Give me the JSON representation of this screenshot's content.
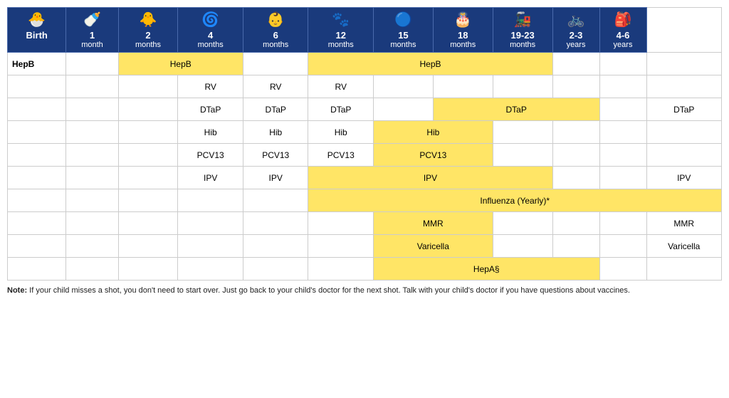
{
  "headers": [
    {
      "icon": "🐣",
      "age": "Birth",
      "sub": ""
    },
    {
      "icon": "🍼",
      "age": "1",
      "sub": "month"
    },
    {
      "icon": "🐥",
      "age": "2",
      "sub": "months"
    },
    {
      "icon": "🌀",
      "age": "4",
      "sub": "months"
    },
    {
      "icon": "👶",
      "age": "6",
      "sub": "months"
    },
    {
      "icon": "🐾",
      "age": "12",
      "sub": "months"
    },
    {
      "icon": "🔵",
      "age": "15",
      "sub": "months"
    },
    {
      "icon": "🎂",
      "age": "18",
      "sub": "months"
    },
    {
      "icon": "🚂",
      "age": "19-23",
      "sub": "months"
    },
    {
      "icon": "🚲",
      "age": "2-3",
      "sub": "years"
    },
    {
      "icon": "🎒",
      "age": "4-6",
      "sub": "years"
    }
  ],
  "rows": [
    {
      "vaccine": "HepB",
      "cells": [
        {
          "col": 0,
          "label": "",
          "yellow": false
        },
        {
          "col": 1,
          "label": "HepB",
          "yellow": true,
          "span": 2
        },
        {
          "col": 3,
          "label": "",
          "yellow": false
        },
        {
          "col": 4,
          "label": "HepB",
          "yellow": true,
          "span": 4
        },
        {
          "col": 8,
          "label": "",
          "yellow": false
        },
        {
          "col": 9,
          "label": "",
          "yellow": false
        },
        {
          "col": 10,
          "label": "",
          "yellow": false
        }
      ]
    },
    {
      "vaccine": "",
      "cells": [
        {
          "col": 0,
          "label": "",
          "yellow": false
        },
        {
          "col": 1,
          "label": "",
          "yellow": false
        },
        {
          "col": 2,
          "label": "RV",
          "yellow": false
        },
        {
          "col": 3,
          "label": "RV",
          "yellow": false
        },
        {
          "col": 4,
          "label": "RV",
          "yellow": false
        },
        {
          "col": 5,
          "label": "",
          "yellow": false
        },
        {
          "col": 6,
          "label": "",
          "yellow": false
        },
        {
          "col": 7,
          "label": "",
          "yellow": false
        },
        {
          "col": 8,
          "label": "",
          "yellow": false
        },
        {
          "col": 9,
          "label": "",
          "yellow": false
        },
        {
          "col": 10,
          "label": "",
          "yellow": false
        }
      ]
    },
    {
      "vaccine": "",
      "cells": [
        {
          "col": 0,
          "label": "",
          "yellow": false
        },
        {
          "col": 1,
          "label": "",
          "yellow": false
        },
        {
          "col": 2,
          "label": "DTaP",
          "yellow": false
        },
        {
          "col": 3,
          "label": "DTaP",
          "yellow": false
        },
        {
          "col": 4,
          "label": "DTaP",
          "yellow": false
        },
        {
          "col": 5,
          "label": "",
          "yellow": false
        },
        {
          "col": 6,
          "label": "DTaP",
          "yellow": true,
          "span": 3
        },
        {
          "col": 9,
          "label": "",
          "yellow": false
        },
        {
          "col": 10,
          "label": "DTaP",
          "yellow": false
        }
      ]
    },
    {
      "vaccine": "",
      "cells": [
        {
          "col": 0,
          "label": "",
          "yellow": false
        },
        {
          "col": 1,
          "label": "",
          "yellow": false
        },
        {
          "col": 2,
          "label": "Hib",
          "yellow": false
        },
        {
          "col": 3,
          "label": "Hib",
          "yellow": false
        },
        {
          "col": 4,
          "label": "Hib",
          "yellow": false
        },
        {
          "col": 5,
          "label": "Hib",
          "yellow": true,
          "span": 2
        },
        {
          "col": 7,
          "label": "",
          "yellow": false
        },
        {
          "col": 8,
          "label": "",
          "yellow": false
        },
        {
          "col": 9,
          "label": "",
          "yellow": false
        },
        {
          "col": 10,
          "label": "",
          "yellow": false
        }
      ]
    },
    {
      "vaccine": "",
      "cells": [
        {
          "col": 0,
          "label": "",
          "yellow": false
        },
        {
          "col": 1,
          "label": "",
          "yellow": false
        },
        {
          "col": 2,
          "label": "PCV13",
          "yellow": false
        },
        {
          "col": 3,
          "label": "PCV13",
          "yellow": false
        },
        {
          "col": 4,
          "label": "PCV13",
          "yellow": false
        },
        {
          "col": 5,
          "label": "PCV13",
          "yellow": true,
          "span": 2
        },
        {
          "col": 7,
          "label": "",
          "yellow": false
        },
        {
          "col": 8,
          "label": "",
          "yellow": false
        },
        {
          "col": 9,
          "label": "",
          "yellow": false
        },
        {
          "col": 10,
          "label": "",
          "yellow": false
        }
      ]
    },
    {
      "vaccine": "",
      "cells": [
        {
          "col": 0,
          "label": "",
          "yellow": false
        },
        {
          "col": 1,
          "label": "",
          "yellow": false
        },
        {
          "col": 2,
          "label": "IPV",
          "yellow": false
        },
        {
          "col": 3,
          "label": "IPV",
          "yellow": false
        },
        {
          "col": 4,
          "label": "IPV",
          "yellow": true,
          "span": 4
        },
        {
          "col": 8,
          "label": "",
          "yellow": false
        },
        {
          "col": 9,
          "label": "",
          "yellow": false
        },
        {
          "col": 10,
          "label": "IPV",
          "yellow": false
        }
      ]
    },
    {
      "vaccine": "",
      "cells": [
        {
          "col": 0,
          "label": "",
          "yellow": false
        },
        {
          "col": 1,
          "label": "",
          "yellow": false
        },
        {
          "col": 2,
          "label": "",
          "yellow": false
        },
        {
          "col": 3,
          "label": "",
          "yellow": false
        },
        {
          "col": 4,
          "label": "Influenza (Yearly)*",
          "yellow": true,
          "span": 7
        }
      ]
    },
    {
      "vaccine": "",
      "cells": [
        {
          "col": 0,
          "label": "",
          "yellow": false
        },
        {
          "col": 1,
          "label": "",
          "yellow": false
        },
        {
          "col": 2,
          "label": "",
          "yellow": false
        },
        {
          "col": 3,
          "label": "",
          "yellow": false
        },
        {
          "col": 4,
          "label": "",
          "yellow": false
        },
        {
          "col": 5,
          "label": "MMR",
          "yellow": true,
          "span": 2
        },
        {
          "col": 7,
          "label": "",
          "yellow": false
        },
        {
          "col": 8,
          "label": "",
          "yellow": false
        },
        {
          "col": 9,
          "label": "",
          "yellow": false
        },
        {
          "col": 10,
          "label": "MMR",
          "yellow": false
        }
      ]
    },
    {
      "vaccine": "",
      "cells": [
        {
          "col": 0,
          "label": "",
          "yellow": false
        },
        {
          "col": 1,
          "label": "",
          "yellow": false
        },
        {
          "col": 2,
          "label": "",
          "yellow": false
        },
        {
          "col": 3,
          "label": "",
          "yellow": false
        },
        {
          "col": 4,
          "label": "",
          "yellow": false
        },
        {
          "col": 5,
          "label": "Varicella",
          "yellow": true,
          "span": 2
        },
        {
          "col": 7,
          "label": "",
          "yellow": false
        },
        {
          "col": 8,
          "label": "",
          "yellow": false
        },
        {
          "col": 9,
          "label": "",
          "yellow": false
        },
        {
          "col": 10,
          "label": "Varicella",
          "yellow": false
        }
      ]
    },
    {
      "vaccine": "",
      "cells": [
        {
          "col": 0,
          "label": "",
          "yellow": false
        },
        {
          "col": 1,
          "label": "",
          "yellow": false
        },
        {
          "col": 2,
          "label": "",
          "yellow": false
        },
        {
          "col": 3,
          "label": "",
          "yellow": false
        },
        {
          "col": 4,
          "label": "",
          "yellow": false
        },
        {
          "col": 5,
          "label": "HepA§",
          "yellow": true,
          "span": 4
        },
        {
          "col": 9,
          "label": "",
          "yellow": false
        },
        {
          "col": 10,
          "label": "",
          "yellow": false
        }
      ]
    }
  ],
  "note": "Note: If your child misses a shot, you don't need to start over. Just go back to your child's doctor for the next shot. Talk with your child's doctor if you have questions about vaccines."
}
